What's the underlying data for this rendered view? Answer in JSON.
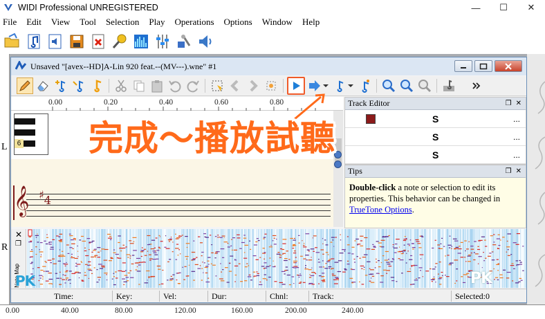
{
  "app": {
    "title": "WIDI Professional UNREGISTERED",
    "window_controls": [
      "—",
      "☐",
      "✕"
    ]
  },
  "menu": [
    "File",
    "Edit",
    "View",
    "Tool",
    "Selection",
    "Play",
    "Operations",
    "Options",
    "Window",
    "Help"
  ],
  "child_window": {
    "title": "Unsaved \"[avex--HD]A-Lin 920 feat.--(MV---).wne\" #1"
  },
  "score": {
    "ruler_ticks": [
      "0.00",
      "0.20",
      "0.40",
      "0.60",
      "0.80"
    ],
    "piano_label": "6",
    "side_letter_top": "L",
    "side_letter_bottom": "R"
  },
  "track_editor": {
    "title": "Track Editor",
    "rows": [
      {
        "s": "S",
        "more": "..."
      },
      {
        "s": "S",
        "more": "..."
      },
      {
        "s": "S",
        "more": "..."
      }
    ]
  },
  "tips": {
    "title": "Tips",
    "bold": "Double-click",
    "text": " a note or selection to edit its properties. This behavior can be changed in ",
    "link": "TrueTone Options",
    "end": "."
  },
  "notemap": {
    "label": "Note Map"
  },
  "status": {
    "time": "Time:",
    "key": "Key:",
    "vel": "Vel:",
    "dur": "Dur:",
    "chnl": "Chnl:",
    "track": "Track:",
    "selected": "Selected:0"
  },
  "bottom_ruler": [
    "0.00",
    "40.00",
    "80.00",
    "120.00",
    "160.00",
    "200.00",
    "240.00"
  ],
  "overlay": {
    "caption": "完成～播放試聽",
    "watermark": "PK"
  },
  "colors": {
    "accent": "#f05a28",
    "caption": "#ff6a1a",
    "link": "#0000ee"
  }
}
